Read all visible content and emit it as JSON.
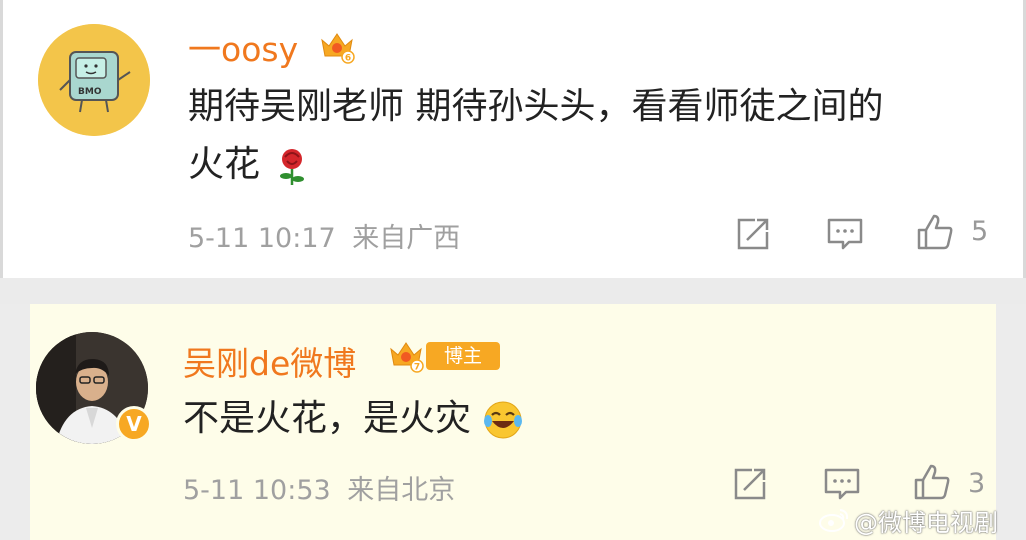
{
  "comments": [
    {
      "username": "一oosy",
      "level_badge": "6",
      "content_line1": "期待吴刚老师 期待孙头头，看看师徒之间的",
      "content_line2": "火花",
      "content_emoji": "rose-emoji",
      "timestamp": "5-11 10:17",
      "location": "来自广西",
      "like_count": "5"
    },
    {
      "username": "吴刚de微博",
      "level_badge": "7",
      "blogger_tag": "博主",
      "verified_badge": "V",
      "content": "不是火花，是火灾",
      "content_emoji": "laugh-cry-emoji",
      "timestamp": "5-11 10:53",
      "location": "来自北京",
      "like_count": "3"
    }
  ],
  "watermark": {
    "text": "@微博电视剧"
  },
  "colors": {
    "username": "#f0781e",
    "meta": "#a0a0a0",
    "highlight_bg": "#fefde9",
    "badge": "#f7a823"
  }
}
